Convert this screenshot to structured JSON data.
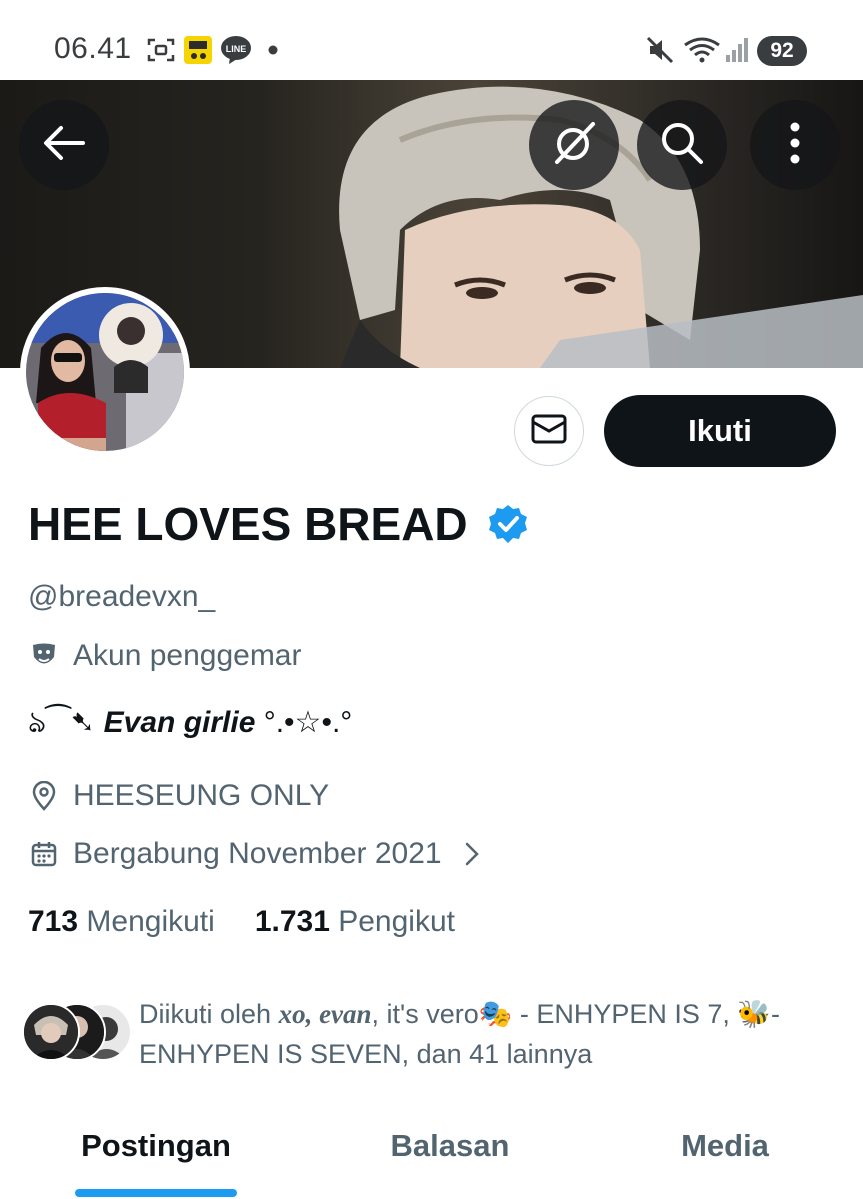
{
  "status_bar": {
    "time": "06.41",
    "battery": "92",
    "icons": [
      "screenshot-icon",
      "app-notification-icon",
      "line-app-icon",
      "dot-icon",
      "mute-icon",
      "wifi-icon",
      "signal-icon",
      "battery-icon"
    ],
    "line_label": "LINE"
  },
  "header": {
    "icons": [
      "back-arrow-icon",
      "grok-icon",
      "search-icon",
      "more-icon"
    ]
  },
  "profile": {
    "display_name": "HEE LOVES BREAD",
    "verified": true,
    "handle": "@breadevxn_",
    "category": "Akun penggemar",
    "bio_prefix": "ঌ⁀➷ ",
    "bio_main": "Evan girlie",
    "bio_suffix": " °.•☆•.°",
    "location": "HEESEUNG ONLY",
    "joined": "Bergabung November 2021",
    "following_count": "713",
    "following_label": "Mengikuti",
    "followers_count": "1.731",
    "followers_label": "Pengikut"
  },
  "actions": {
    "follow_label": "Ikuti",
    "message_icon": "mail-icon"
  },
  "followed_by": {
    "prefix": "Diikuti oleh ",
    "name1": "xo, evan",
    "part2": ", it's vero🎭 - ENHYPEN IS 7, 🐝- ENHYPEN IS SEVEN, dan 41 lainnya"
  },
  "tabs": [
    {
      "label": "Postingan",
      "active": true
    },
    {
      "label": "Balasan",
      "active": false
    },
    {
      "label": "Media",
      "active": false
    }
  ],
  "colors": {
    "accent": "#1d9bf0",
    "text_primary": "#0f1419",
    "text_secondary": "#536471",
    "follow_button": "#0f1419"
  }
}
